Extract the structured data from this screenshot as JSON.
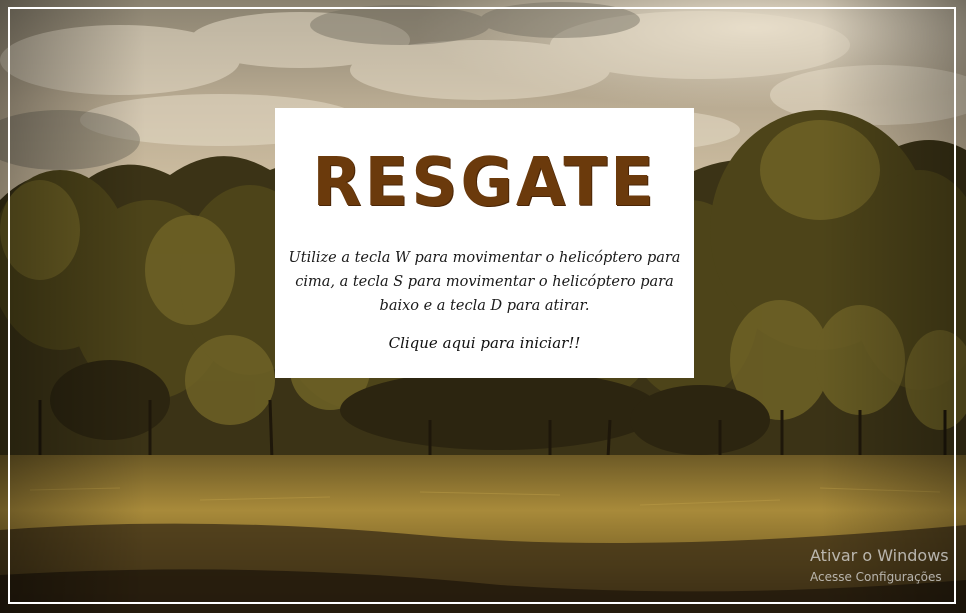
{
  "game": {
    "title": "RESGATE",
    "instructions": "Utilize a tecla W para movimentar o helicóptero para cima, a tecla S para movimentar o helicóptero para baixo e a tecla D para atirar.",
    "start_label": "Clique aqui para iniciar!!"
  },
  "os_watermark": {
    "title": "Ativar o Windows",
    "subtitle": "Acesse Configurações"
  },
  "colors": {
    "title": "#6b3a0c",
    "panel_background": "#ffffff",
    "frame_border": "#ffffff"
  }
}
